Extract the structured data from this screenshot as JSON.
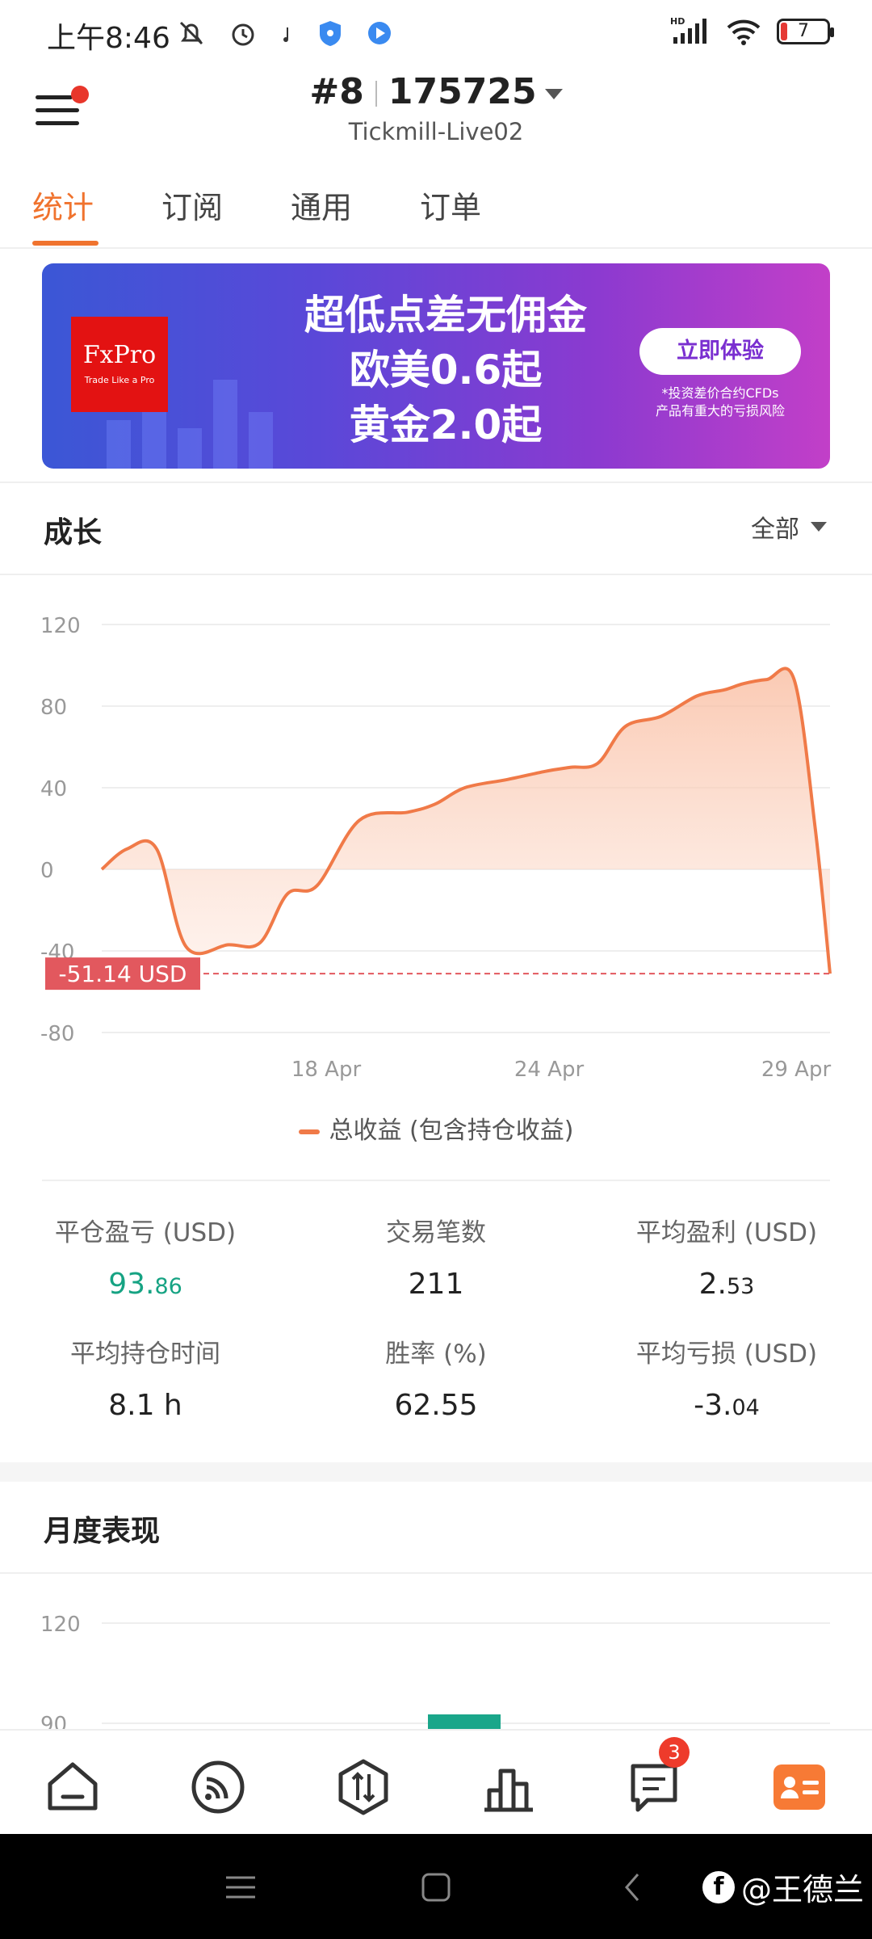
{
  "status_bar": {
    "time": "上午8:46",
    "network": "HD",
    "battery": "7"
  },
  "header": {
    "account_id": "#8",
    "account_number": "175725",
    "server": "Tickmill-Live02"
  },
  "tabs": [
    {
      "label": "统计",
      "active": true
    },
    {
      "label": "订阅",
      "active": false
    },
    {
      "label": "通用",
      "active": false
    },
    {
      "label": "订单",
      "active": false
    }
  ],
  "banner": {
    "brand": "FxPro",
    "brand_tagline": "Trade Like a Pro",
    "headline_1": "超低点差无佣金",
    "headline_2": "欧美0.6起",
    "headline_3": "黄金2.0起",
    "cta": "立即体验",
    "disclaimer_1": "*投资差价合约CFDs",
    "disclaimer_2": "产品有重大的亏损风险"
  },
  "growth": {
    "title": "成长",
    "filter": "全部",
    "current_label": "-51.14 USD",
    "legend": "总收益 (包含持仓收益)"
  },
  "chart_data": {
    "type": "area",
    "y_ticks": [
      "120",
      "80",
      "40",
      "0",
      "-40",
      "-80"
    ],
    "x_ticks": [
      "18 Apr",
      "24 Apr",
      "29 Apr"
    ],
    "ylim": [
      -80,
      120
    ],
    "current_value": -51.14,
    "series": [
      {
        "name": "总收益 (包含持仓收益)",
        "color": "#f07a48",
        "x": [
          0,
          1.2,
          2.6,
          4,
          6,
          7.5,
          8.8,
          10.2,
          12.2,
          14.5,
          15.8,
          17.2,
          19.2,
          21,
          22.2,
          23.5,
          24.8,
          26.5,
          28.2,
          29.5,
          30.4,
          31.5,
          32.8,
          33.8,
          34.5
        ],
        "values": [
          0,
          10,
          10,
          -38,
          -37,
          -36,
          -12,
          -8,
          24,
          28,
          32,
          40,
          44,
          48,
          50,
          52,
          70,
          75,
          85,
          88,
          91,
          93,
          93,
          20,
          -51.14
        ]
      }
    ]
  },
  "stats": [
    {
      "label": "平仓盈亏 (USD)",
      "int": "93.",
      "dec": "86",
      "color": "green"
    },
    {
      "label": "交易笔数",
      "int": "211",
      "dec": "",
      "color": "default"
    },
    {
      "label": "平均盈利 (USD)",
      "int": "2.",
      "dec": "53",
      "color": "default"
    },
    {
      "label": "平均持仓时间",
      "int": "8.1 h",
      "dec": "",
      "color": "default"
    },
    {
      "label": "胜率 (%)",
      "int": "62.55",
      "dec": "",
      "color": "default"
    },
    {
      "label": "平均亏损 (USD)",
      "int": "-3.",
      "dec": "04",
      "color": "default"
    }
  ],
  "monthly": {
    "title": "月度表现",
    "y_ticks": [
      "120",
      "90"
    ],
    "bar_color": "#1aa68a"
  },
  "bottom_nav": {
    "messages_badge": "3"
  },
  "watermark": "@王德兰"
}
